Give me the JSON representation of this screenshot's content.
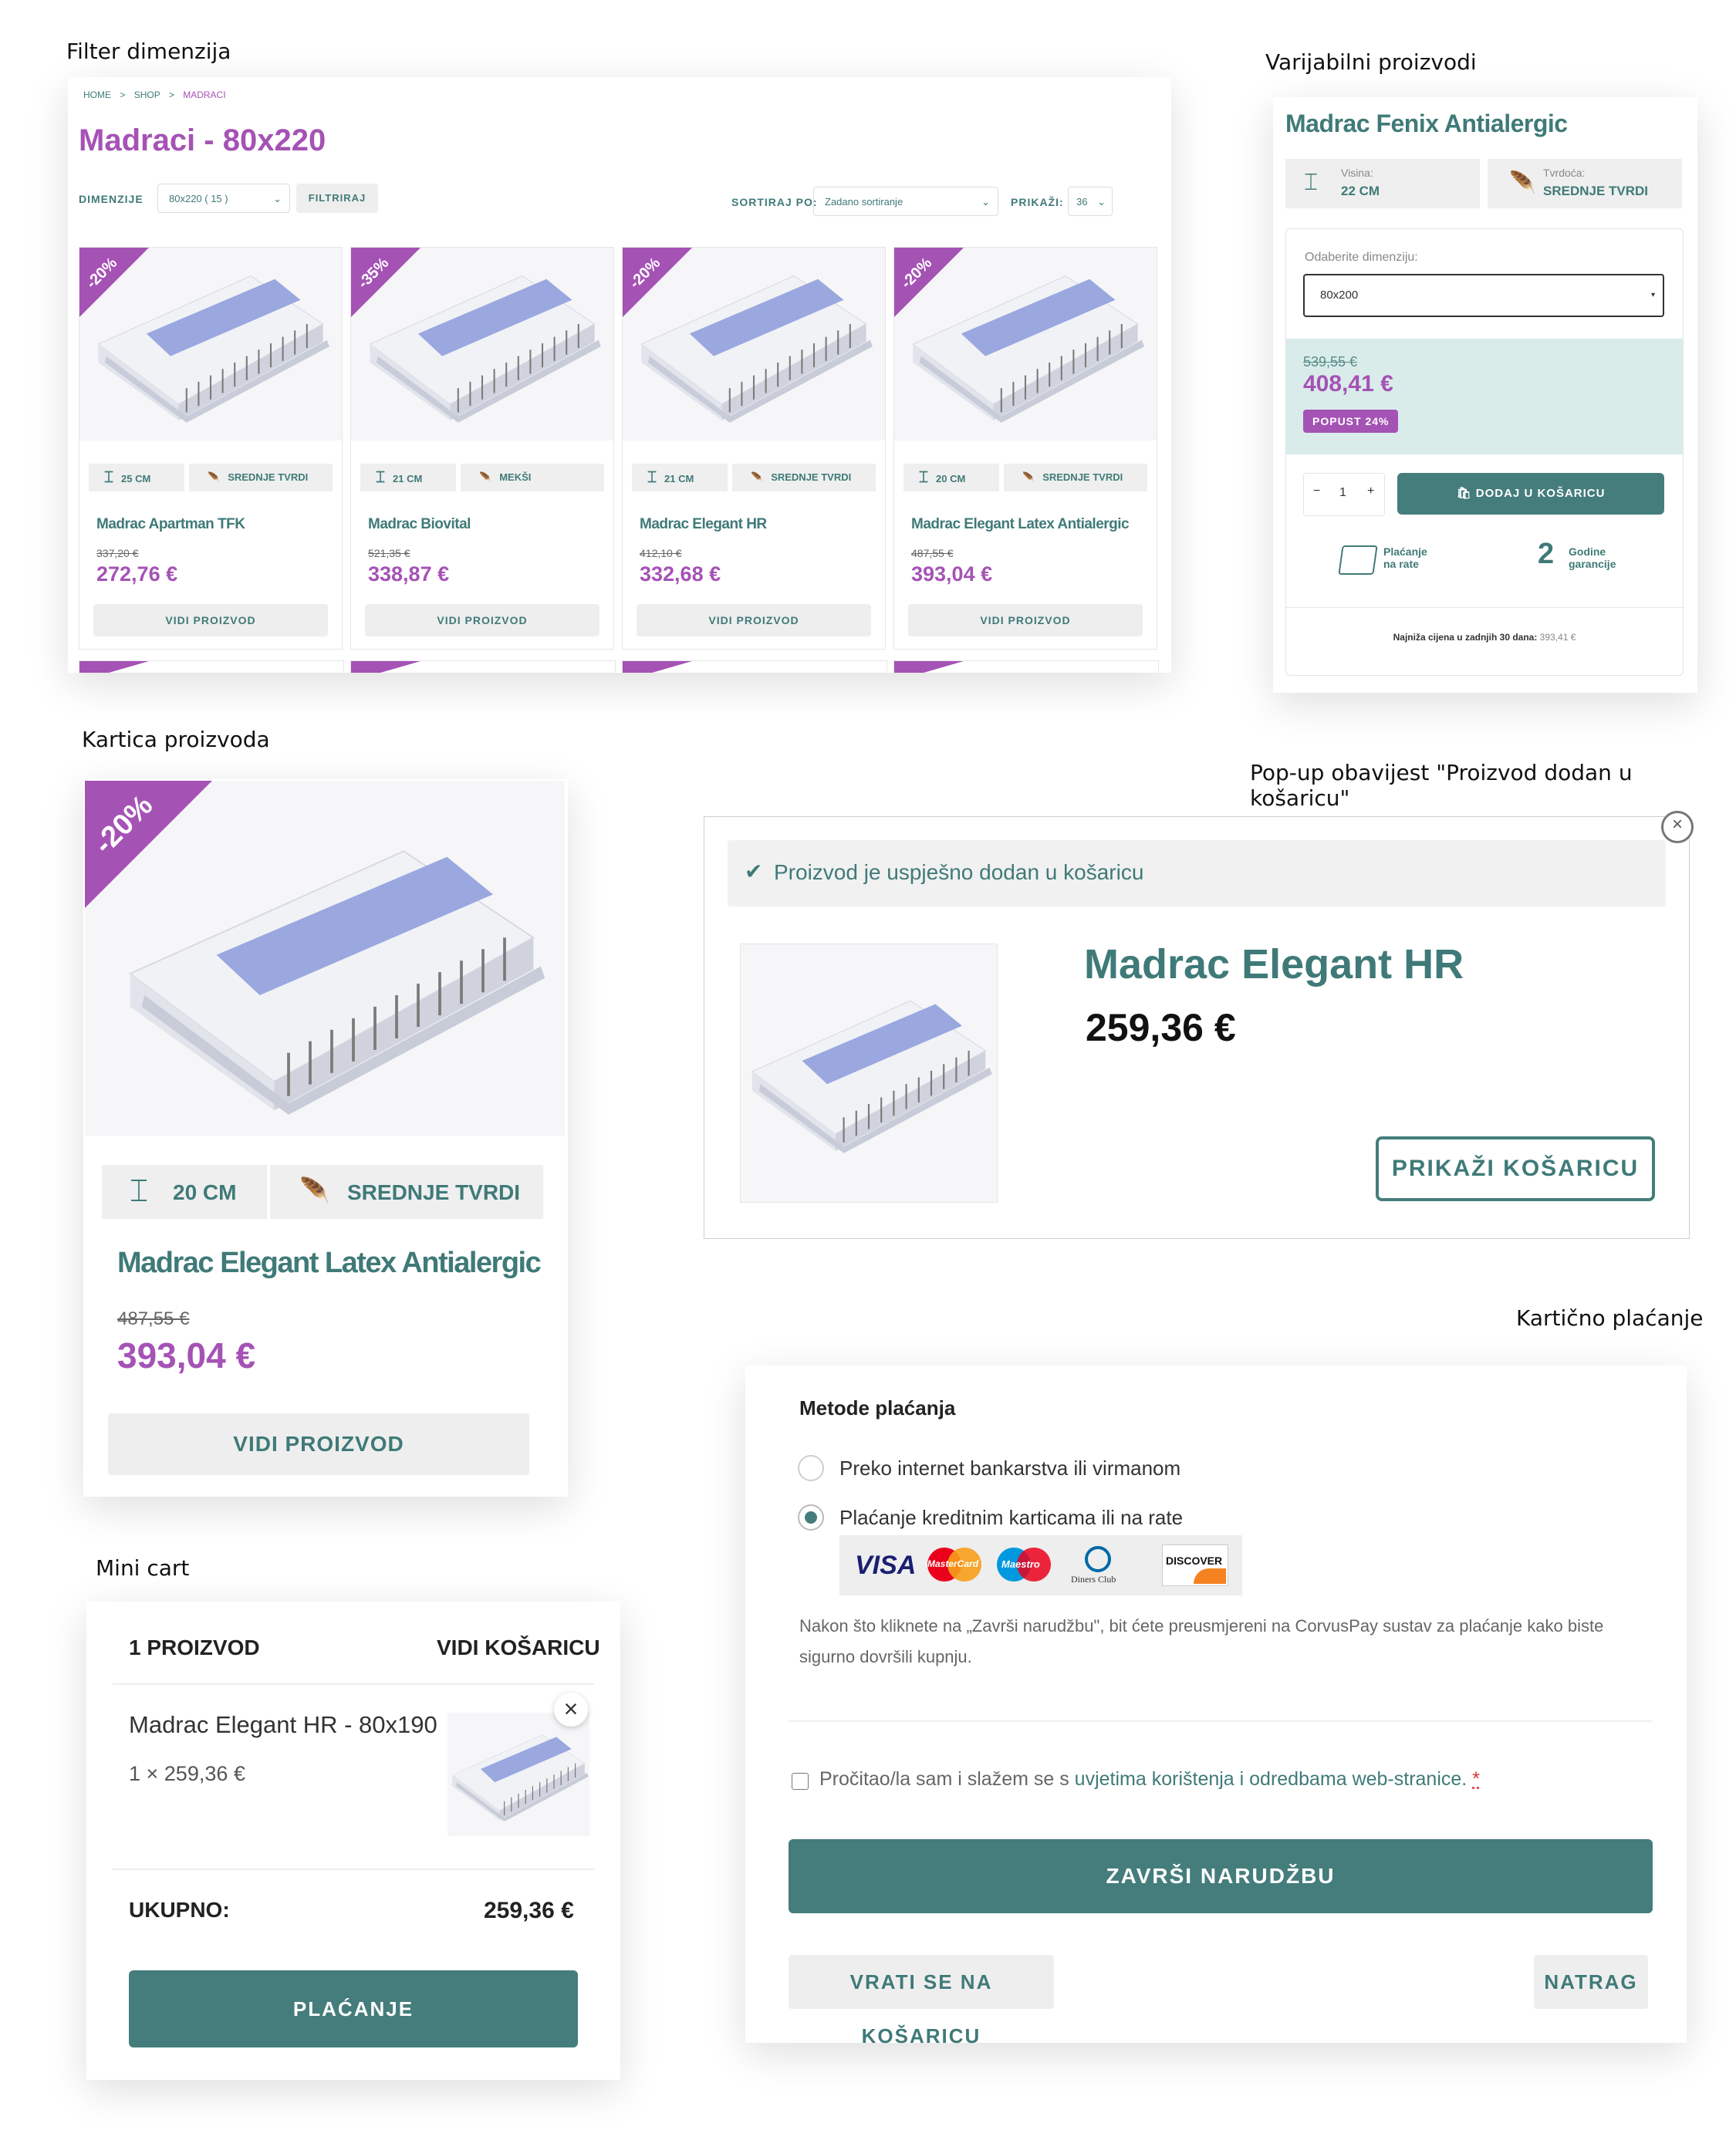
{
  "sections": {
    "filter": "Filter dimenzija",
    "variable": "Varijabilni proizvodi",
    "card": "Kartica proizvoda",
    "popup": "Pop-up obavijest \"Proizvod dodan u košaricu\"",
    "payment": "Kartično plaćanje",
    "minicart": "Mini cart"
  },
  "shop": {
    "breadcrumb": [
      "HOME",
      "SHOP",
      "MADRACI"
    ],
    "breadcrumb_sep": ">",
    "title": "Madraci - 80x220",
    "dim_label": "DIMENZIJE",
    "dim_value": "80x220 ( 15 )",
    "filter_btn": "FILTRIRAJ",
    "sort_label": "SORTIRAJ PO:",
    "sort_value": "Zadano sortiranje",
    "show_label": "PRIKAŽI:",
    "show_value": "36",
    "view_btn": "VIDI PROIZVOD",
    "products": [
      {
        "badge": "-20%",
        "height": "25 CM",
        "firmness": "SREDNJE TVRDI",
        "name": "Madrac Apartman TFK",
        "old": "337,20 €",
        "price": "272,76 €",
        "core": "#c8c8c8"
      },
      {
        "badge": "-35%",
        "height": "21 CM",
        "firmness": "MEKŠI",
        "name": "Madrac Biovital",
        "old": "521,35 €",
        "price": "338,87 €",
        "core": "#efe8b4"
      },
      {
        "badge": "-20%",
        "height": "21 CM",
        "firmness": "SREDNJE TVRDI",
        "name": "Madrac Elegant HR",
        "old": "412,10 €",
        "price": "332,68 €",
        "core": "#9aa8df"
      },
      {
        "badge": "-20%",
        "height": "20 CM",
        "firmness": "SREDNJE TVRDI",
        "name": "Madrac Elegant Latex Antialergic",
        "old": "487,55 €",
        "price": "393,04 €",
        "core": "#efe8b4"
      }
    ]
  },
  "variable": {
    "name": "Madrac Fenix Antialergic",
    "height_label": "Visina:",
    "height_value": "22 CM",
    "firm_label": "Tvrdoća:",
    "firm_value": "SREDNJE TVRDI",
    "select_label": "Odaberite dimenziju:",
    "select_value": "80x200",
    "old": "539,55 €",
    "price": "408,41 €",
    "discount": "POPUST 24%",
    "qty": "1",
    "minus": "−",
    "plus": "+",
    "add": "DODAJ U KOŠARICU",
    "feature1_line1": "Plaćanje",
    "feature1_line2": "na rate",
    "feature2_number": "2",
    "feature2_line1": "Godine",
    "feature2_line2": "garancije",
    "lowest_label": "Najniža cijena u zadnjih 30 dana:",
    "lowest_value": "393,41 €"
  },
  "card": {
    "badge": "-20%",
    "height": "20 CM",
    "firmness": "SREDNJE TVRDI",
    "name": "Madrac Elegant Latex Antialergic",
    "old": "487,55 €",
    "price": "393,04 €",
    "btn": "VIDI PROIZVOD"
  },
  "popup": {
    "notice": "Proizvod je uspješno dodan u košaricu",
    "name": "Madrac Elegant HR",
    "price": "259,36 €",
    "btn": "PRIKAŽI KOŠARICU"
  },
  "payment": {
    "title": "Metode plaćanja",
    "option1": "Preko internet bankarstva ili virmanom",
    "option2": "Plaćanje kreditnim karticama ili na rate",
    "cards": [
      "VISA",
      "MasterCard",
      "Maestro",
      "Diners Club",
      "DISCOVER"
    ],
    "note": "Nakon što kliknete na „Završi narudžbu\", bit ćete preusmjereni na CorvusPay sustav za plaćanje kako biste sigurno dovršili kupnju.",
    "terms_pre": "Pročitao/la sam i slažem se s",
    "terms_link": "uvjetima korištenja i odredbama web-stranice.",
    "terms_req": "*",
    "submit": "ZAVRŠI NARUDŽBU",
    "back_cart": "VRATI SE NA KOŠARICU",
    "back": "NATRAG"
  },
  "minicart": {
    "count": "1 PROIZVOD",
    "view": "VIDI KOŠARICU",
    "item": "Madrac Elegant HR - 80x190",
    "qty_price": "1 × 259,36 €",
    "remove": "×",
    "total_label": "UKUPNO:",
    "total": "259,36 €",
    "checkout": "PLAĆANJE"
  },
  "colors": {
    "teal": "#447d7b",
    "purple": "#a552b5",
    "teal_light": "#d9ecea"
  }
}
